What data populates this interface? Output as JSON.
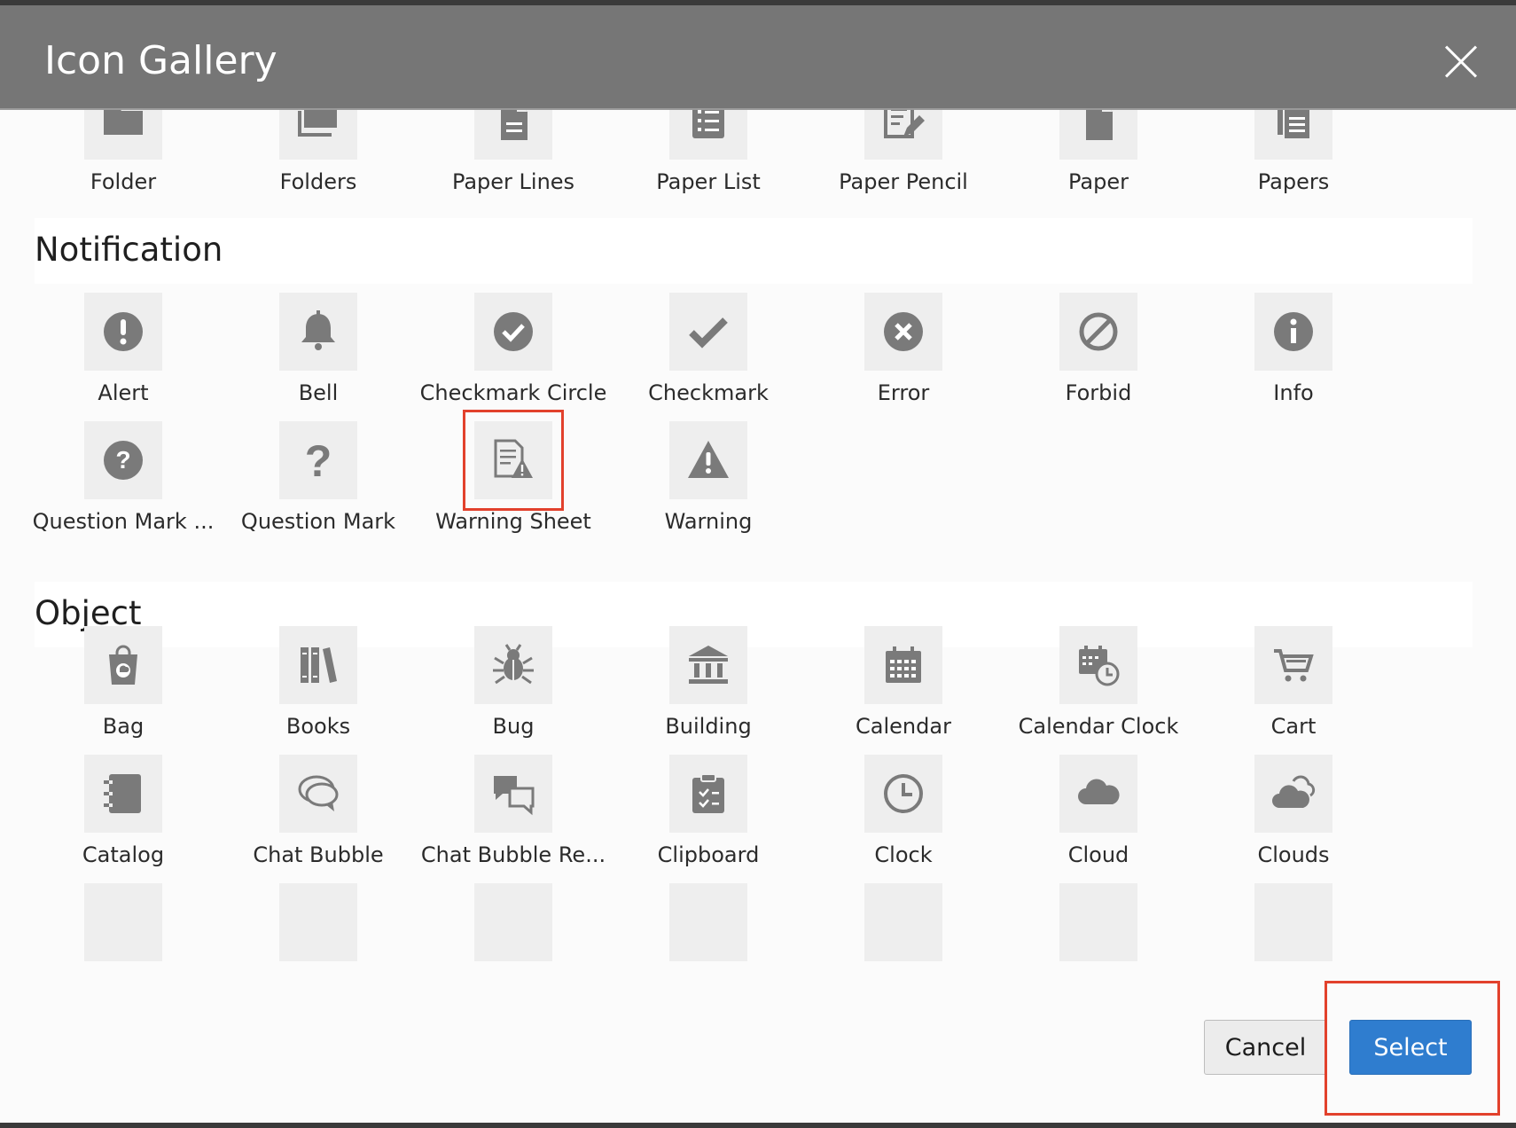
{
  "dialog": {
    "title": "Icon Gallery"
  },
  "colors": {
    "header": "#767676",
    "icon": "#7a7a7a",
    "tile": "#eeeeee",
    "primary": "#2f7dcf",
    "highlight": "#e2412c"
  },
  "rows": {
    "partial_top": [
      {
        "label": "Folder",
        "icon": "folder-icon"
      },
      {
        "label": "Folders",
        "icon": "folders-icon"
      },
      {
        "label": "Paper Lines",
        "icon": "paper-lines-icon"
      },
      {
        "label": "Paper List",
        "icon": "paper-list-icon"
      },
      {
        "label": "Paper Pencil",
        "icon": "paper-pencil-icon"
      },
      {
        "label": "Paper",
        "icon": "paper-icon"
      },
      {
        "label": "Papers",
        "icon": "papers-icon"
      }
    ]
  },
  "sections": [
    {
      "title": "Notification",
      "items": [
        {
          "label": "Alert",
          "icon": "alert-icon"
        },
        {
          "label": "Bell",
          "icon": "bell-icon"
        },
        {
          "label": "Checkmark Circle",
          "icon": "checkmark-circle-icon"
        },
        {
          "label": "Checkmark",
          "icon": "checkmark-icon"
        },
        {
          "label": "Error",
          "icon": "error-icon"
        },
        {
          "label": "Forbid",
          "icon": "forbid-icon"
        },
        {
          "label": "Info",
          "icon": "info-icon"
        },
        {
          "label": "Question Mark ...",
          "icon": "question-mark-circle-icon"
        },
        {
          "label": "Question Mark",
          "icon": "question-mark-icon"
        },
        {
          "label": "Warning Sheet",
          "icon": "warning-sheet-icon",
          "selected": true
        },
        {
          "label": "Warning",
          "icon": "warning-icon"
        }
      ]
    },
    {
      "title": "Object",
      "items": [
        {
          "label": "Bag",
          "icon": "bag-icon"
        },
        {
          "label": "Books",
          "icon": "books-icon"
        },
        {
          "label": "Bug",
          "icon": "bug-icon"
        },
        {
          "label": "Building",
          "icon": "building-icon"
        },
        {
          "label": "Calendar",
          "icon": "calendar-icon"
        },
        {
          "label": "Calendar Clock",
          "icon": "calendar-clock-icon"
        },
        {
          "label": "Cart",
          "icon": "cart-icon"
        },
        {
          "label": "Catalog",
          "icon": "catalog-icon"
        },
        {
          "label": "Chat Bubble",
          "icon": "chat-bubble-icon"
        },
        {
          "label": "Chat Bubble Re...",
          "icon": "chat-bubbles-icon"
        },
        {
          "label": "Clipboard",
          "icon": "clipboard-icon"
        },
        {
          "label": "Clock",
          "icon": "clock-icon"
        },
        {
          "label": "Cloud",
          "icon": "cloud-icon"
        },
        {
          "label": "Clouds",
          "icon": "clouds-icon"
        }
      ]
    }
  ],
  "footer": {
    "cancel_label": "Cancel",
    "select_label": "Select"
  }
}
